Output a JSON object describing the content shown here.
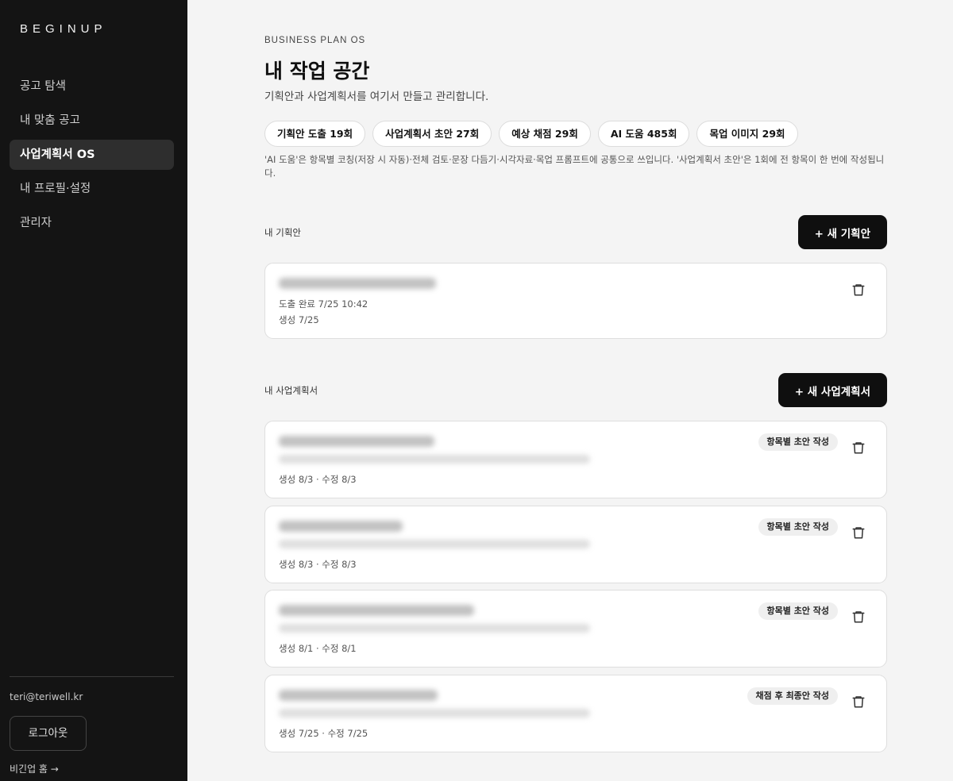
{
  "sidebar": {
    "logo": "BEGINUP",
    "items": [
      {
        "label": "공고 탐색"
      },
      {
        "label": "내 맞춤 공고"
      },
      {
        "label": "사업계획서 OS"
      },
      {
        "label": "내 프로필·설정"
      },
      {
        "label": "관리자"
      }
    ],
    "active_index": 2,
    "email": "teri@teriwell.kr",
    "logout_label": "로그아웃",
    "home_link": "비긴업 홈 →"
  },
  "header": {
    "eyebrow": "BUSINESS PLAN OS",
    "title": "내 작업 공간",
    "subtitle": "기획안과 사업계획서를 여기서 만들고 관리합니다."
  },
  "quotas": [
    {
      "label": "기획안 도출 19회"
    },
    {
      "label": "사업계획서 초안 27회"
    },
    {
      "label": "예상 채점 29회"
    },
    {
      "label": "AI 도움 485회"
    },
    {
      "label": "목업 이미지 29회"
    }
  ],
  "note": "'AI 도움'은 항목별 코칭(저장 시 자동)·전체 검토·문장 다듬기·시각자료·목업 프롬프트에 공통으로 쓰입니다. '사업계획서 초안'은 1회에 전 항목이 한 번에 작성됩니다.",
  "plans_section": {
    "label": "내 기획안",
    "new_button": "+ 새 기획안",
    "items": [
      {
        "derived": "도출 완료 7/25 10:42",
        "created": "생성 7/25"
      }
    ]
  },
  "bp_section": {
    "label": "내 사업계획서",
    "new_button": "+ 새 사업계획서",
    "items": [
      {
        "tag": "항목별 초안 작성",
        "dates": "생성 8/3 · 수정 8/3"
      },
      {
        "tag": "항목별 초안 작성",
        "dates": "생성 8/3 · 수정 8/3"
      },
      {
        "tag": "항목별 초안 작성",
        "dates": "생성 8/1 · 수정 8/1"
      },
      {
        "tag": "채점 후 최종안 작성",
        "dates": "생성 7/25 · 수정 7/25"
      }
    ]
  },
  "icons": {
    "delete": "trash-icon"
  },
  "colors": {
    "sidebar_bg": "#141414",
    "page_bg": "#f4f4f4",
    "primary": "#0f0f0f"
  }
}
